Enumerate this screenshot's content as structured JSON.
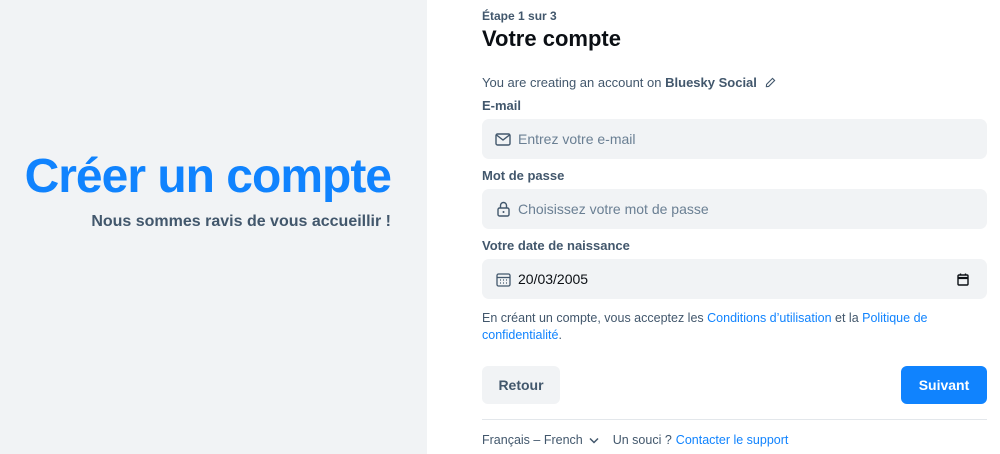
{
  "hero": {
    "title": "Créer un compte",
    "subtitle": "Nous sommes ravis de vous accueillir !"
  },
  "form": {
    "step": "Étape 1 sur 3",
    "title": "Votre compte",
    "service_prefix": "You are creating an account on",
    "service_name": "Bluesky Social",
    "email": {
      "label": "E-mail",
      "placeholder": "Entrez votre e-mail",
      "value": ""
    },
    "password": {
      "label": "Mot de passe",
      "placeholder": "Choisissez votre mot de passe",
      "value": ""
    },
    "birthdate": {
      "label": "Votre date de naissance",
      "value": "20/03/2005"
    },
    "legal": {
      "prefix": "En créant un compte, vous acceptez les",
      "terms_link": "Conditions d’utilisation",
      "middle": "et la",
      "privacy_link": "Politique de confidentialité",
      "suffix": "."
    },
    "back_label": "Retour",
    "next_label": "Suivant"
  },
  "footer": {
    "language": "Français – French",
    "help_prefix": "Un souci ?",
    "support_link": "Contacter le support"
  },
  "colors": {
    "accent": "#1083fe",
    "panel_bg": "#f1f3f5",
    "muted_text": "#42576c"
  },
  "icons": {
    "edit": "pencil-icon",
    "email": "envelope-icon",
    "password": "lock-icon",
    "date": "calendar-icon",
    "date_picker": "calendar-picker-icon",
    "language": "chevron-down-icon"
  }
}
